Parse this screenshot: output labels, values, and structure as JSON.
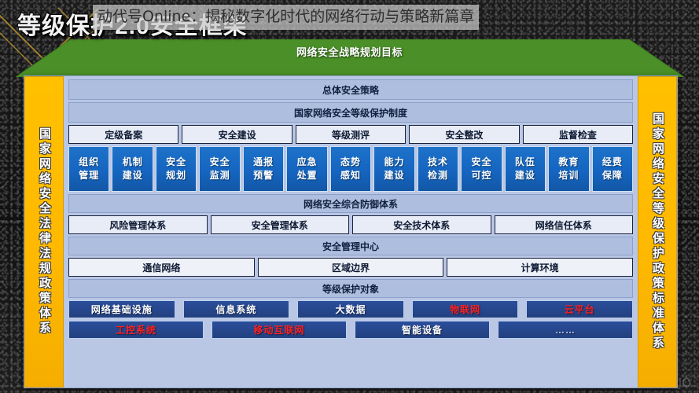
{
  "headline": "等级保护2.0安全框架",
  "overlay_caption": "动代号Online：揭秘数字化时代的网络行动与策略新篇章",
  "roof": {
    "label": "网络安全战略规划目标"
  },
  "pillars": {
    "left": "国家网络安全法律法规政策体系",
    "right": "国家网络安全等级保护政策标准体系"
  },
  "bands": {
    "overall_policy": "总体安全策略",
    "mlps_system": "国家网络安全等级保护制度",
    "comprehensive_defense": "网络安全综合防御体系",
    "security_mgmt_center": "安全管理中心",
    "protection_object": "等级保护对象"
  },
  "lifecycle": [
    "定级备案",
    "安全建设",
    "等级测评",
    "安全整改",
    "监督检查"
  ],
  "capabilities": [
    "组织\n管理",
    "机制\n建设",
    "安全\n规划",
    "安全\n监测",
    "通报\n预警",
    "应急\n处置",
    "态势\n感知",
    "能力\n建设",
    "技术\n检测",
    "安全\n可控",
    "队伍\n建设",
    "教育\n培训",
    "经费\n保障"
  ],
  "systems": [
    "风险管理体系",
    "安全管理体系",
    "安全技术体系",
    "网络信任体系"
  ],
  "protection_areas": [
    "通信网络",
    "区域边界",
    "计算环境"
  ],
  "objects_row1": [
    {
      "label": "网络基础设施",
      "color": "#ffffff"
    },
    {
      "label": "信息系统",
      "color": "#ffffff"
    },
    {
      "label": "大数据",
      "color": "#ffffff"
    },
    {
      "label": "物联网",
      "color": "#ff2020"
    },
    {
      "label": "云平台",
      "color": "#ff2020"
    }
  ],
  "objects_row2": [
    {
      "label": "工控系统",
      "color": "#ff2020"
    },
    {
      "label": "移动互联网",
      "color": "#ff2020"
    },
    {
      "label": "智能设备",
      "color": "#ffffff"
    },
    {
      "label": "……",
      "color": "#c8d6ef"
    }
  ],
  "watermark": "JO",
  "colors": {
    "pillar": "#ffc000",
    "roof": "#4a8f27",
    "band": "#aebedf",
    "blue_box": "#1565c0",
    "dark_box": "#22407f",
    "accent_red": "#ff2020"
  }
}
